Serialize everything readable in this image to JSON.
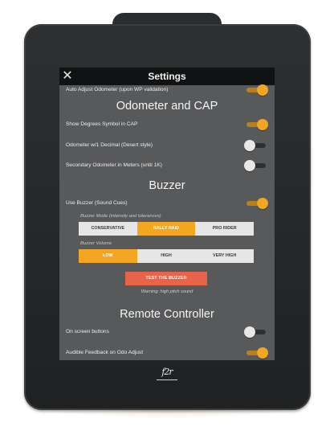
{
  "header": {
    "title": "Settings",
    "close_icon": "close-icon"
  },
  "rows": {
    "auto_adjust": {
      "label": "Auto Adjust Odometer (upon WP validation)",
      "on": true
    },
    "degrees": {
      "label": "Show Degrees Symbol in CAP",
      "on": true
    },
    "decimal": {
      "label": "Odometer w/1 Decimal (Desert style)",
      "on": false
    },
    "secondary": {
      "label": "Secondary Odometer in Meters (until 1K)",
      "on": false
    },
    "buzzer": {
      "label": "Use Buzzer (Sound Cues)",
      "on": true
    },
    "onscreen": {
      "label": "On screen buttons",
      "on": false
    },
    "audible": {
      "label": "Audible Feedback on Odo Adjust",
      "on": true
    }
  },
  "sections": {
    "odometer": "Odometer and CAP",
    "buzzer": "Buzzer",
    "remote": "Remote Controller"
  },
  "buzzer_mode": {
    "label": "Buzzer Mode (intensity and tolerances)",
    "options": [
      "CONSERVATIVE",
      "RALLY RAID",
      "PRO RIDER"
    ],
    "selected": "RALLY RAID"
  },
  "buzzer_volume": {
    "label": "Buzzer Volume",
    "options": [
      "LOW",
      "HIGH",
      "VERY HIGH"
    ],
    "selected": "LOW"
  },
  "test_button": "TEST THE BUZZER",
  "warning": "Warning: high pitch sound",
  "logo": "f2r",
  "colors": {
    "accent": "#f4a623",
    "button": "#e7644a",
    "screen": "#58595b",
    "topbar": "#111213"
  }
}
